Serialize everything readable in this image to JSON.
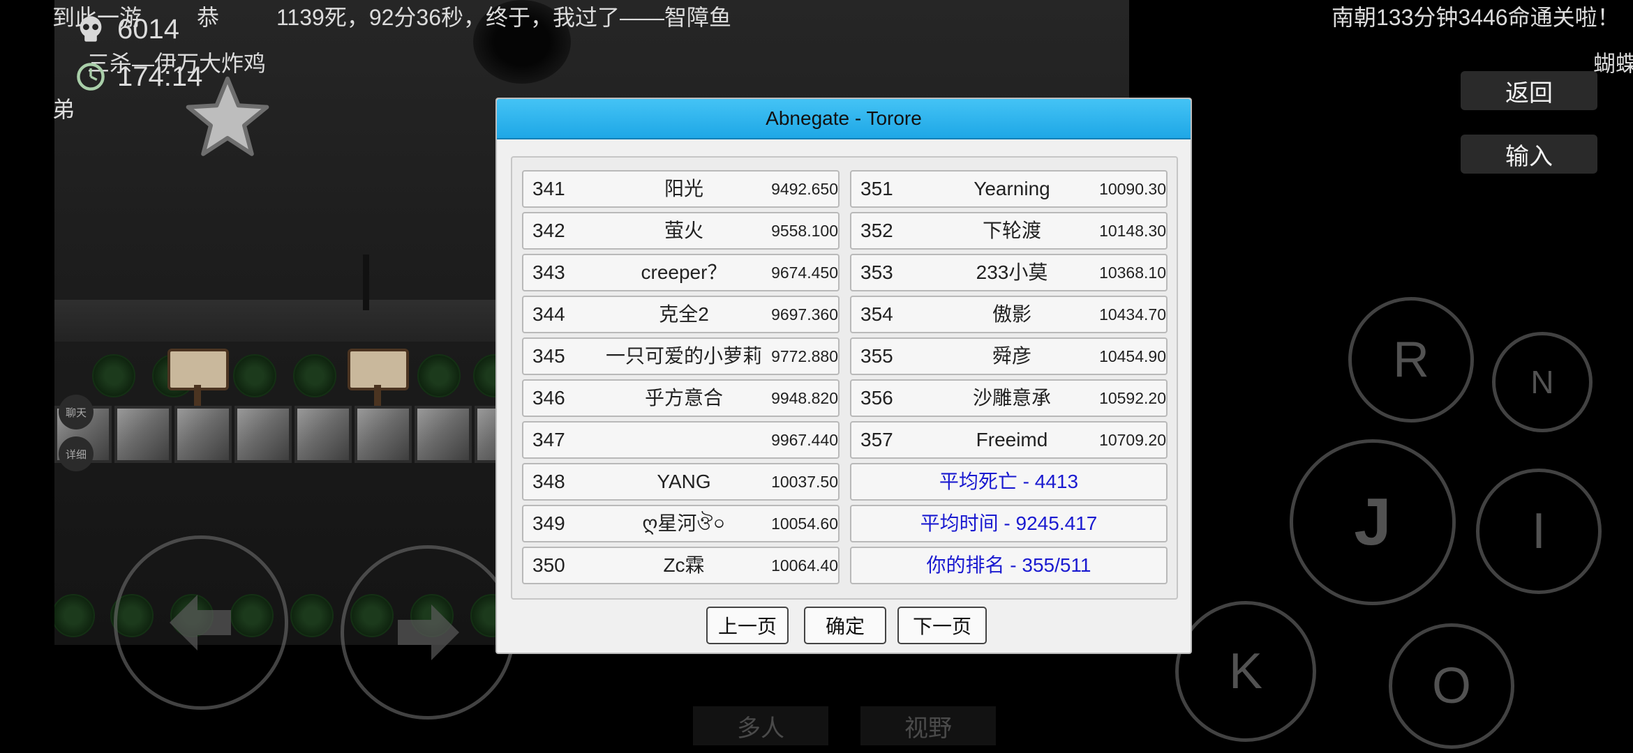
{
  "hud": {
    "chat_line_1": "到此一游",
    "chat_line_2": "恭",
    "chat_line_3": "1139死，92分36秒，终于，我过了——智障鱼",
    "chat_line_4": "三杀—伊万大炸鸡",
    "chat_line_5": "弟",
    "chat_right_1": "南朝133分钟3446命通关啦！",
    "chat_right_2": "蝴蝶",
    "death_count": "6014",
    "time": "174:14",
    "chat_bubble": "聊天",
    "detail_bubble": "详细"
  },
  "right_menu": {
    "back": "返回",
    "input": "输入"
  },
  "controls": {
    "r": "R",
    "n": "N",
    "j": "J",
    "i": "I",
    "k": "K",
    "o": "O"
  },
  "bottom_tabs": {
    "multiplayer": "多人",
    "view": "视野"
  },
  "dialog": {
    "title": "Abnegate - Torore",
    "left_rows": [
      {
        "rank": "341",
        "name": "阳光",
        "score": "9492.650"
      },
      {
        "rank": "342",
        "name": "萤火",
        "score": "9558.100"
      },
      {
        "rank": "343",
        "name": "creeper？",
        "score": "9674.450"
      },
      {
        "rank": "344",
        "name": "克全2",
        "score": "9697.360"
      },
      {
        "rank": "345",
        "name": "一只可爱的小萝莉",
        "score": "9772.880"
      },
      {
        "rank": "346",
        "name": "乎方意合",
        "score": "9948.820"
      },
      {
        "rank": "347",
        "name": "",
        "score": "9967.440"
      },
      {
        "rank": "348",
        "name": "YANG",
        "score": "10037.50"
      },
      {
        "rank": "349",
        "name": "ღ星河ঔ০",
        "score": "10054.60"
      },
      {
        "rank": "350",
        "name": "Zc霖",
        "score": "10064.40"
      }
    ],
    "right_rows": [
      {
        "rank": "351",
        "name": "Yearning",
        "score": "10090.30"
      },
      {
        "rank": "352",
        "name": "下轮渡",
        "score": "10148.30"
      },
      {
        "rank": "353",
        "name": "233小莫",
        "score": "10368.10"
      },
      {
        "rank": "354",
        "name": "傲影",
        "score": "10434.70"
      },
      {
        "rank": "355",
        "name": "舜彦",
        "score": "10454.90"
      },
      {
        "rank": "356",
        "name": "沙雕意承",
        "score": "10592.20"
      },
      {
        "rank": "357",
        "name": "Freeimd",
        "score": "10709.20"
      }
    ],
    "stats": {
      "avg_deaths": "平均死亡 - 4413",
      "avg_time": "平均时间 - 9245.417",
      "your_rank": "你的排名 - 355/511"
    },
    "buttons": {
      "prev": "上一页",
      "ok": "确定",
      "next": "下一页"
    }
  },
  "colors": {
    "title_bar": "#1ea7e6",
    "stat_text": "#1a1ad0"
  }
}
